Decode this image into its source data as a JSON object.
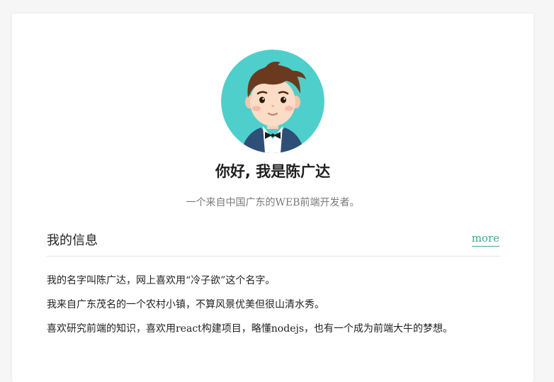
{
  "profile": {
    "greeting": "你好, 我是陈广达",
    "tagline": "一个来自中国广东的WEB前端开发者。"
  },
  "section": {
    "title": "我的信息",
    "more_label": "more",
    "paragraphs": [
      "我的名字叫陈广达，网上喜欢用“冷子欲”这个名字。",
      "我来自广东茂名的一个农村小镇，不算风景优美但很山清水秀。",
      "喜欢研究前端的知识，喜欢用react构建项目，略懂nodejs，也有一个成为前端大牛的梦想。"
    ]
  },
  "colors": {
    "accent": "#3fa88f",
    "avatar_bg": "#4fcfcb",
    "muted_text": "#7a7a7a",
    "background": "#f6f6f6"
  },
  "icons": {
    "avatar": "cartoon-boy-avatar"
  }
}
